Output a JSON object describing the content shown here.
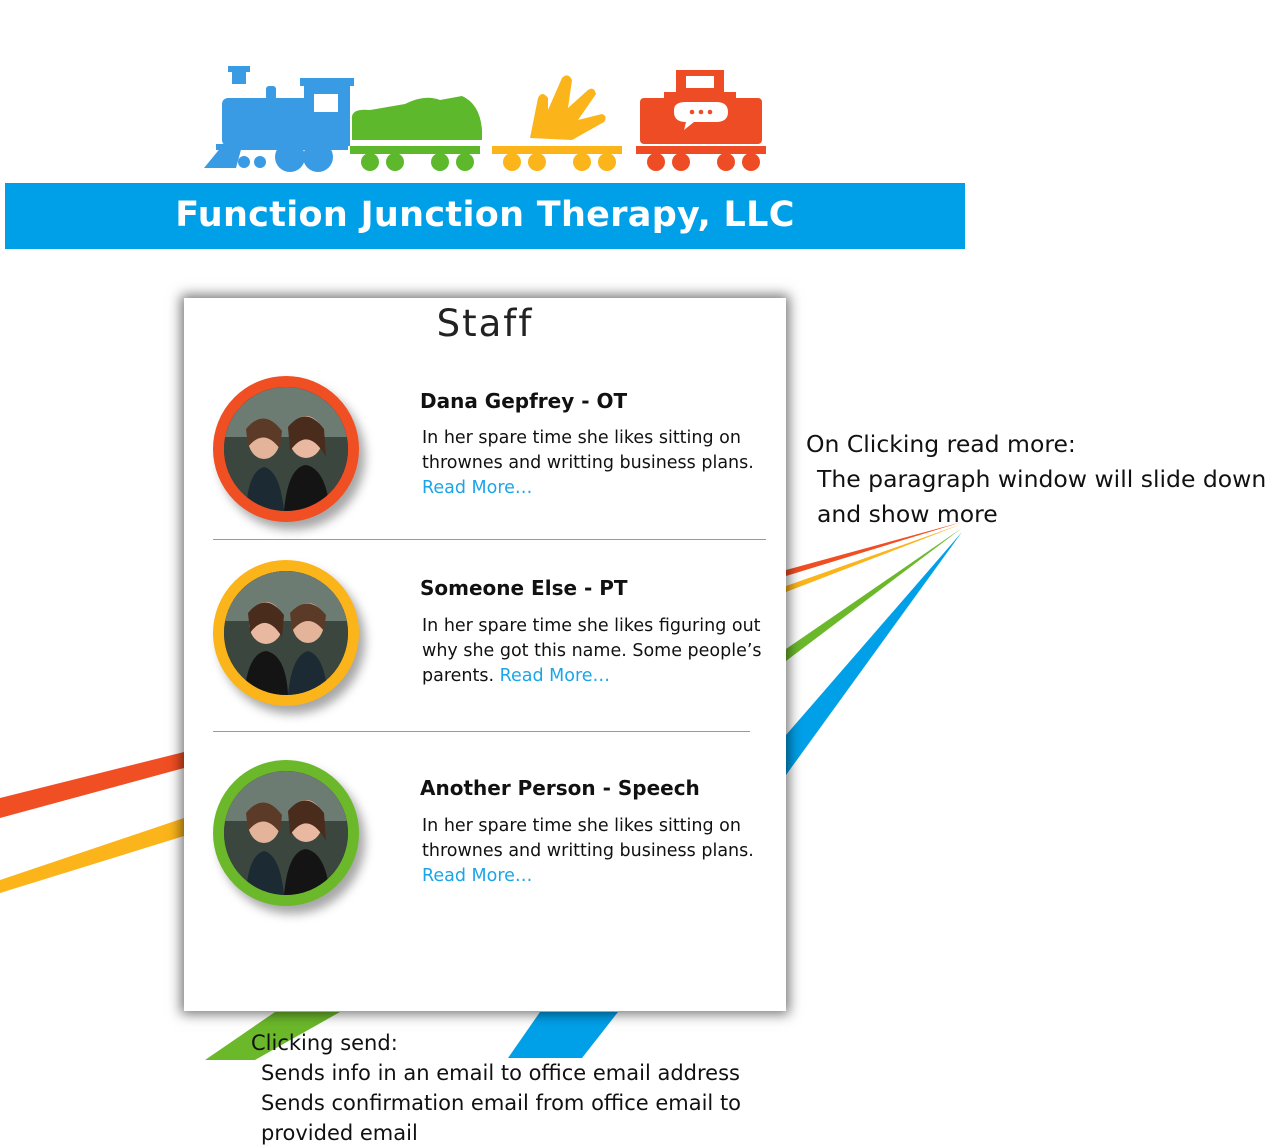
{
  "header": {
    "title": "Function Junction Therapy, LLC",
    "banner_color": "#00a0e9",
    "train_cars": [
      "train-engine-icon",
      "shoe-icon",
      "hand-icon",
      "caboose-speech-icon"
    ],
    "car_colors": [
      "#3a9be5",
      "#5db82b",
      "#fbb41a",
      "#ee4c24"
    ]
  },
  "staff_panel": {
    "title": "Staff",
    "members": [
      {
        "name": "Dana Gepfrey - OT",
        "bio": "In her spare time she likes sitting on thrownes and writting business plans.",
        "read_more": "Read More…",
        "ring_color": "#f04e23"
      },
      {
        "name": "Someone Else - PT",
        "bio": "In her spare time she likes figuring out why she got this name.  Some people’s parents.",
        "read_more": "Read More…",
        "ring_color": "#fbb41a"
      },
      {
        "name": "Another Person - Speech",
        "bio": "In her spare time she likes sitting on thrownes and writting business plans.",
        "read_more": "Read More…",
        "ring_color": "#6bb82b"
      }
    ]
  },
  "annotations": {
    "read_more": {
      "heading": "On Clicking read more:",
      "lines": [
        "The paragraph window will slide down",
        "and show more"
      ]
    },
    "send": {
      "heading": "Clicking send:",
      "lines": [
        "Sends info in an email to office email address",
        "Sends confirmation email from office email to",
        "provided email"
      ]
    }
  }
}
